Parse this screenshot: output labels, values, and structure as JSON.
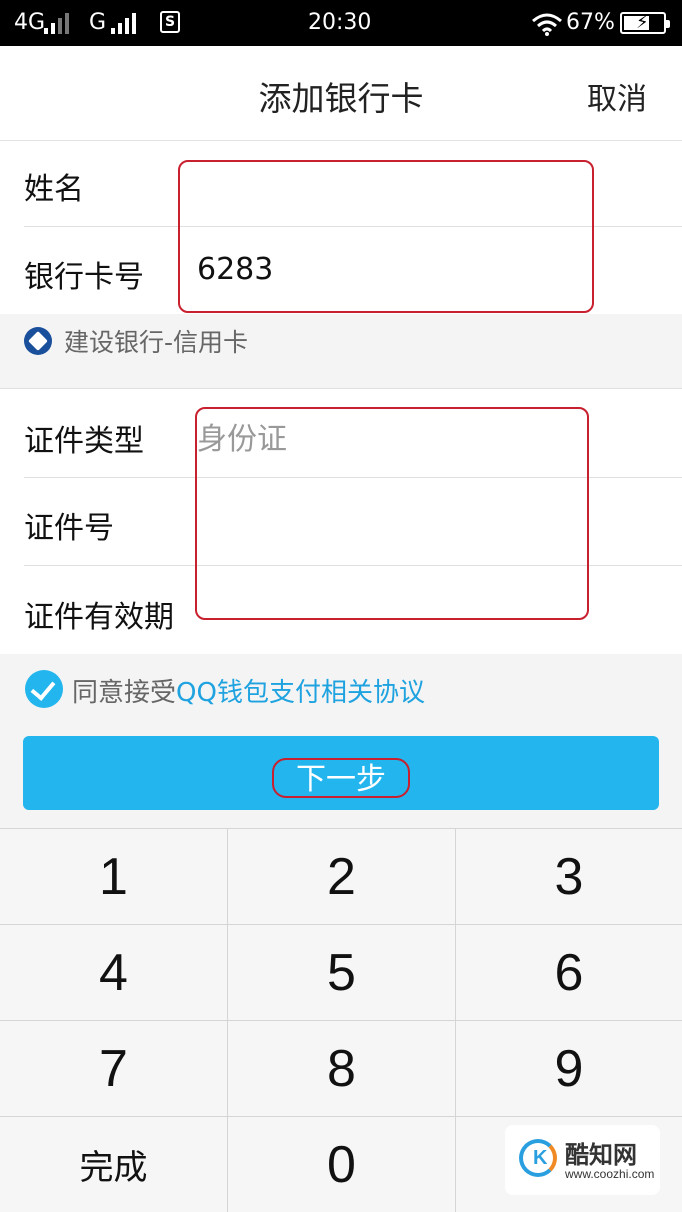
{
  "status_bar": {
    "network_1": "4G",
    "network_2": "G",
    "sim_label": "S",
    "time": "20:30",
    "battery_text": "67%",
    "battery_level": 0.67,
    "icons": [
      "signal-icon",
      "wifi-icon",
      "battery-icon"
    ]
  },
  "nav": {
    "title": "添加银行卡",
    "cancel_label": "取消"
  },
  "card_section": {
    "name_label": "姓名",
    "name_value": "",
    "card_number_label": "银行卡号",
    "card_number_value": "6283"
  },
  "bank_info": {
    "bank_name": "建设银行-信用卡",
    "logo_icon": "ccb-bank-logo-icon"
  },
  "id_section": {
    "id_type_label": "证件类型",
    "id_type_placeholder": "身份证",
    "id_number_label": "证件号",
    "id_number_value": "",
    "id_expiry_label": "证件有效期",
    "id_expiry_value": ""
  },
  "agreement": {
    "checked": true,
    "prefix_text": "同意接受",
    "link_text": "QQ钱包支付相关协议"
  },
  "next_button": {
    "label": "下一步"
  },
  "keypad": {
    "keys": [
      "1",
      "2",
      "3",
      "4",
      "5",
      "6",
      "7",
      "8",
      "9",
      "完成",
      "0",
      ""
    ]
  },
  "watermark": {
    "logo_letter": "K",
    "brand": "酷知网",
    "url": "www.coozhi.com"
  },
  "colors": {
    "accent": "#22b5ee",
    "link": "#1fa3e0",
    "highlight_box": "#c8202e",
    "bank_logo": "#1a4f9c"
  }
}
